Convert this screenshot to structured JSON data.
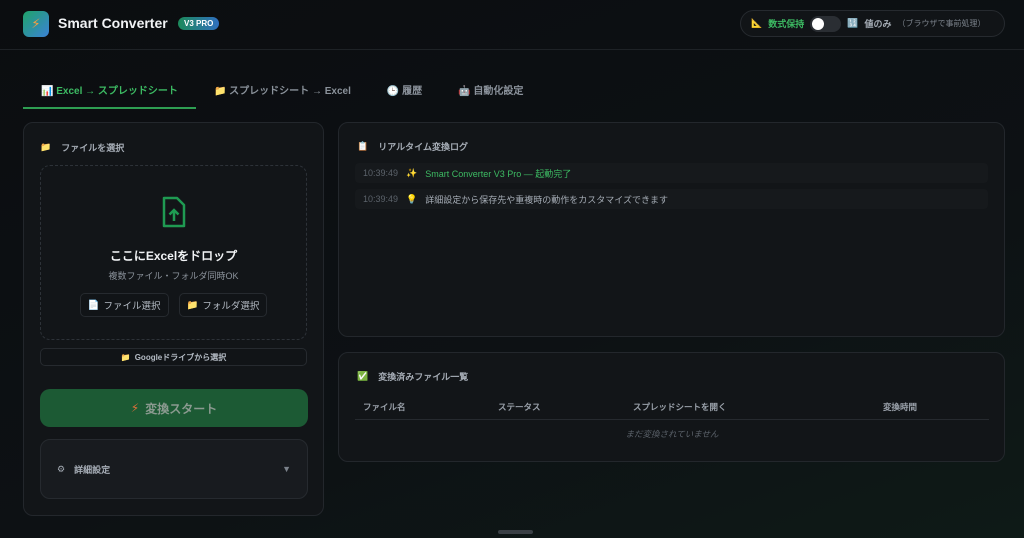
{
  "app": {
    "title": "Smart Converter",
    "badge": "V3 PRO",
    "logo_icon": "⚡"
  },
  "mode": {
    "formula_icon": "📐",
    "formula_label": "数式保持",
    "toggle_on": false,
    "values_icon": "🔢",
    "values_label": "値のみ",
    "values_note": "（ブラウザで事前処理）"
  },
  "tabs": [
    {
      "icon": "📊",
      "label": "Excel → スプレッドシート"
    },
    {
      "icon": "📁",
      "label": "スプレッドシート → Excel"
    },
    {
      "icon": "🕒",
      "label": "履歴"
    },
    {
      "icon": "🤖",
      "label": "自動化設定"
    }
  ],
  "file_panel": {
    "icon": "📁",
    "title": "ファイルを選択",
    "drop_title": "ここにExcelをドロップ",
    "drop_sub": "複数ファイル・フォルダ同時OK",
    "file_btn_icon": "📄",
    "file_btn": "ファイル選択",
    "folder_btn_icon": "📁",
    "folder_btn": "フォルダ選択",
    "gdrive_icon": "📁",
    "gdrive": "Googleドライブから選択",
    "start_icon": "⚡",
    "start": "変換スタート",
    "settings_icon": "⚙",
    "settings": "詳細設定",
    "chevron": "▼"
  },
  "log": {
    "icon": "📋",
    "title": "リアルタイム変換ログ",
    "entries": [
      {
        "time": "10:39:49",
        "icon": "✨",
        "text": "Smart Converter V3 Pro — 起動完了",
        "color": "#3dbb63"
      },
      {
        "time": "10:39:49",
        "icon": "💡",
        "text": "詳細設定から保存先や重複時の動作をカスタマイズできます",
        "color": "#a6adb6"
      }
    ]
  },
  "files": {
    "icon": "✅",
    "title": "変換済みファイル一覧",
    "columns": [
      "ファイル名",
      "ステータス",
      "スプレッドシートを開く",
      "変換時間"
    ],
    "empty": "まだ変換されていません"
  }
}
